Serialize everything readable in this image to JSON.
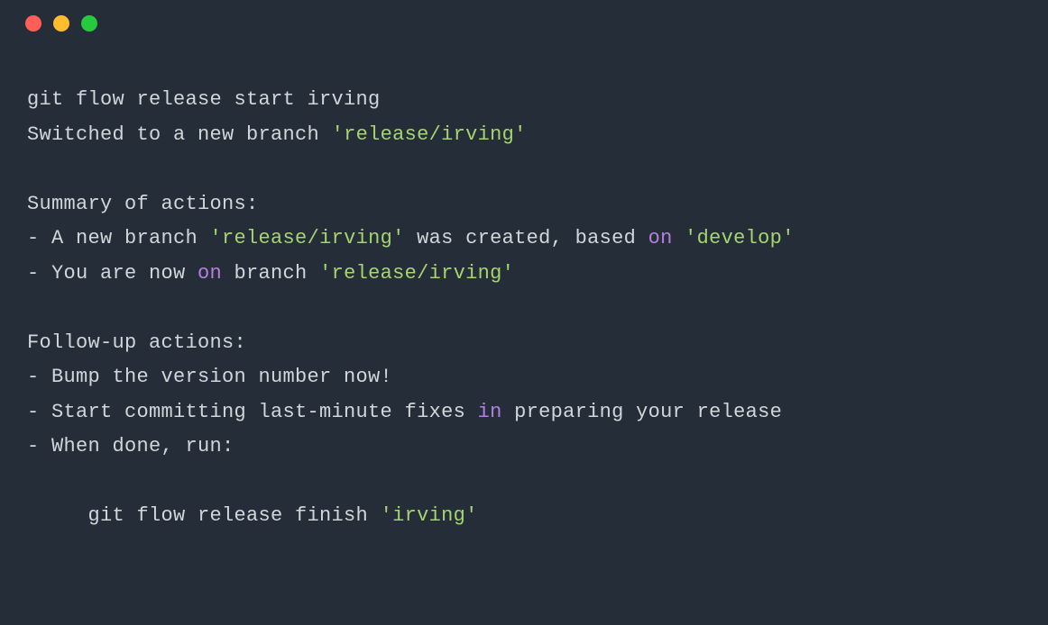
{
  "terminal": {
    "lines": [
      [
        {
          "text": "git flow release start irving",
          "cls": "txt-default"
        }
      ],
      [
        {
          "text": "Switched to a new branch ",
          "cls": "txt-default"
        },
        {
          "text": "'release/irving'",
          "cls": "txt-string"
        }
      ],
      [
        {
          "text": " ",
          "cls": "txt-default"
        }
      ],
      [
        {
          "text": "Summary of actions:",
          "cls": "txt-default"
        }
      ],
      [
        {
          "text": "- A new branch ",
          "cls": "txt-default"
        },
        {
          "text": "'release/irving'",
          "cls": "txt-string"
        },
        {
          "text": " was created, based ",
          "cls": "txt-default"
        },
        {
          "text": "on",
          "cls": "txt-keyword"
        },
        {
          "text": " ",
          "cls": "txt-default"
        },
        {
          "text": "'develop'",
          "cls": "txt-string"
        }
      ],
      [
        {
          "text": "- You are now ",
          "cls": "txt-default"
        },
        {
          "text": "on",
          "cls": "txt-keyword"
        },
        {
          "text": " branch ",
          "cls": "txt-default"
        },
        {
          "text": "'release/irving'",
          "cls": "txt-string"
        }
      ],
      [
        {
          "text": " ",
          "cls": "txt-default"
        }
      ],
      [
        {
          "text": "Follow-up actions:",
          "cls": "txt-default"
        }
      ],
      [
        {
          "text": "- Bump the version number now!",
          "cls": "txt-default"
        }
      ],
      [
        {
          "text": "- Start committing last-minute fixes ",
          "cls": "txt-default"
        },
        {
          "text": "in",
          "cls": "txt-keyword"
        },
        {
          "text": " preparing your release",
          "cls": "txt-default"
        }
      ],
      [
        {
          "text": "- When done, run:",
          "cls": "txt-default"
        }
      ],
      [
        {
          "text": " ",
          "cls": "txt-default"
        }
      ],
      [
        {
          "text": "     git flow release finish ",
          "cls": "txt-default"
        },
        {
          "text": "'irving'",
          "cls": "txt-string"
        }
      ]
    ]
  }
}
